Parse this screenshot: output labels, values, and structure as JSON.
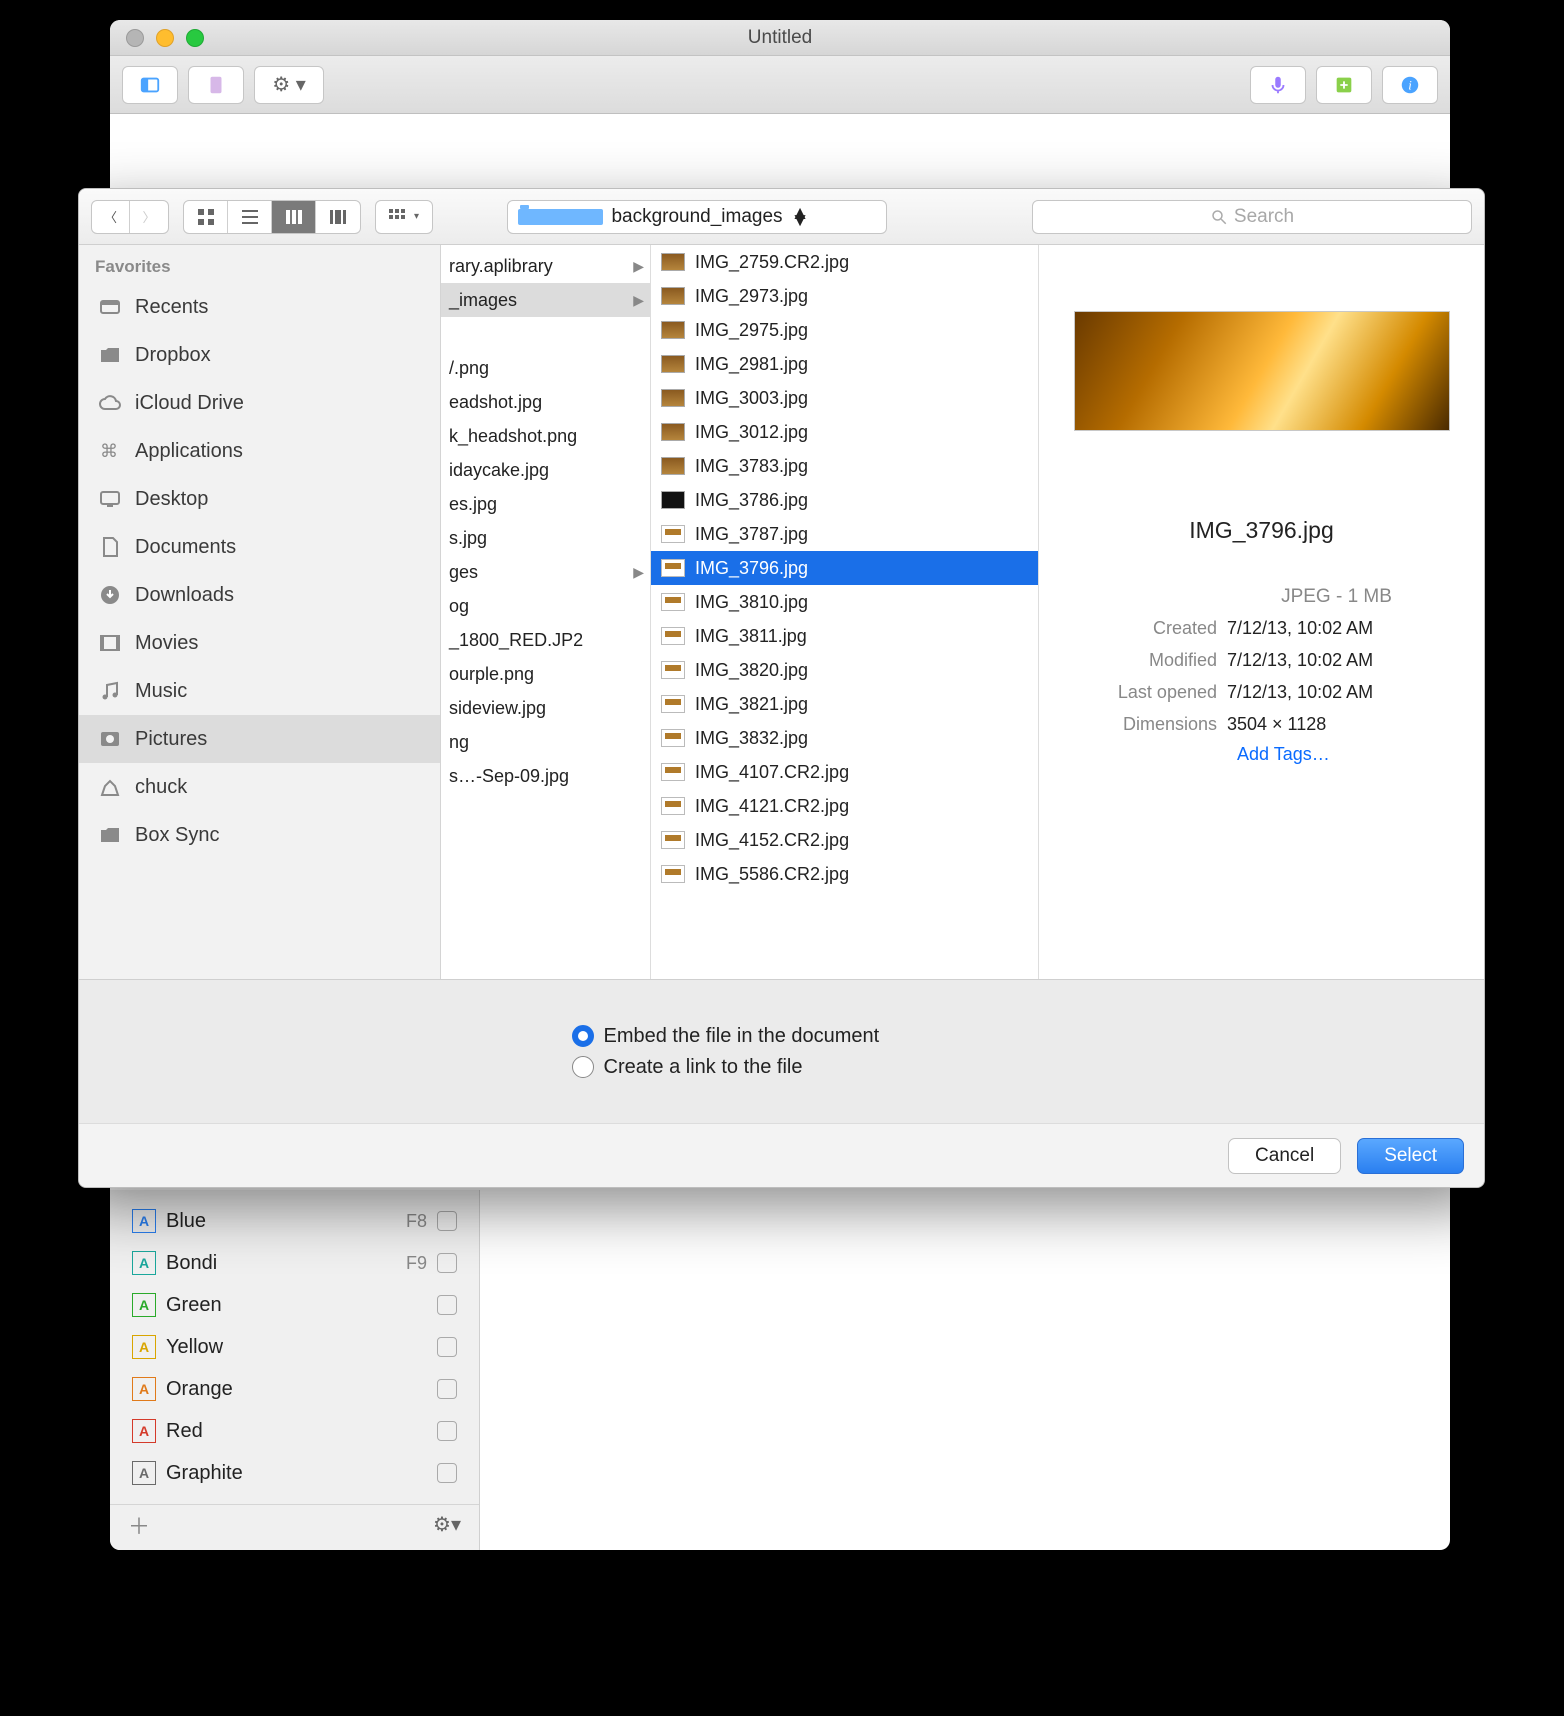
{
  "parentWindow": {
    "title": "Untitled"
  },
  "search": {
    "placeholder": "Search"
  },
  "folderPopup": {
    "name": "background_images"
  },
  "favoritesHeader": "Favorites",
  "favorites": [
    {
      "label": "Recents"
    },
    {
      "label": "Dropbox"
    },
    {
      "label": "iCloud Drive"
    },
    {
      "label": "Applications"
    },
    {
      "label": "Desktop"
    },
    {
      "label": "Documents"
    },
    {
      "label": "Downloads"
    },
    {
      "label": "Movies"
    },
    {
      "label": "Music"
    },
    {
      "label": "Pictures"
    },
    {
      "label": "chuck"
    },
    {
      "label": "Box Sync"
    }
  ],
  "col1": [
    {
      "label": "rary.aplibrary",
      "arrow": true
    },
    {
      "label": "_images",
      "arrow": true,
      "selected": true
    },
    {
      "label": ""
    },
    {
      "label": "/.png"
    },
    {
      "label": "eadshot.jpg"
    },
    {
      "label": "k_headshot.png"
    },
    {
      "label": "idaycake.jpg"
    },
    {
      "label": "es.jpg"
    },
    {
      "label": "s.jpg"
    },
    {
      "label": "ges",
      "arrow": true
    },
    {
      "label": "og"
    },
    {
      "label": "_1800_RED.JP2"
    },
    {
      "label": "ourple.png"
    },
    {
      "label": "sideview.jpg"
    },
    {
      "label": "ng"
    },
    {
      "label": "s…-Sep-09.jpg"
    }
  ],
  "files": [
    {
      "name": "IMG_2759.CR2.jpg",
      "t": "img"
    },
    {
      "name": "IMG_2973.jpg",
      "t": "img"
    },
    {
      "name": "IMG_2975.jpg",
      "t": "img"
    },
    {
      "name": "IMG_2981.jpg",
      "t": "img"
    },
    {
      "name": "IMG_3003.jpg",
      "t": "img"
    },
    {
      "name": "IMG_3012.jpg",
      "t": "img"
    },
    {
      "name": "IMG_3783.jpg",
      "t": "img"
    },
    {
      "name": "IMG_3786.jpg",
      "t": "dark"
    },
    {
      "name": "IMG_3787.jpg",
      "t": "prev"
    },
    {
      "name": "IMG_3796.jpg",
      "t": "prev",
      "selected": true
    },
    {
      "name": "IMG_3810.jpg",
      "t": "prev"
    },
    {
      "name": "IMG_3811.jpg",
      "t": "prev"
    },
    {
      "name": "IMG_3820.jpg",
      "t": "prev"
    },
    {
      "name": "IMG_3821.jpg",
      "t": "prev"
    },
    {
      "name": "IMG_3832.jpg",
      "t": "prev"
    },
    {
      "name": "IMG_4107.CR2.jpg",
      "t": "prev"
    },
    {
      "name": "IMG_4121.CR2.jpg",
      "t": "prev"
    },
    {
      "name": "IMG_4152.CR2.jpg",
      "t": "prev"
    },
    {
      "name": "IMG_5586.CR2.jpg",
      "t": "prev"
    }
  ],
  "preview": {
    "filename": "IMG_3796.jpg",
    "typeLine": "JPEG - 1 MB",
    "meta": [
      {
        "k": "Created",
        "v": "7/12/13, 10:02 AM"
      },
      {
        "k": "Modified",
        "v": "7/12/13, 10:02 AM"
      },
      {
        "k": "Last opened",
        "v": "7/12/13, 10:02 AM"
      },
      {
        "k": "Dimensions",
        "v": "3504 × 1128"
      }
    ],
    "addTags": "Add Tags…"
  },
  "options": {
    "embed": "Embed the file in the document",
    "link": "Create a link to the file"
  },
  "buttons": {
    "cancel": "Cancel",
    "select": "Select"
  },
  "styles": [
    {
      "label": "Blue",
      "color": "#2a7ff0",
      "key": "F8"
    },
    {
      "label": "Bondi",
      "color": "#1aa79c",
      "key": "F9"
    },
    {
      "label": "Green",
      "color": "#2aaa2a",
      "key": ""
    },
    {
      "label": "Yellow",
      "color": "#d9a500",
      "key": ""
    },
    {
      "label": "Orange",
      "color": "#e07a1a",
      "key": ""
    },
    {
      "label": "Red",
      "color": "#d43a2a",
      "key": ""
    },
    {
      "label": "Graphite",
      "color": "#6a6a6a",
      "key": ""
    }
  ]
}
